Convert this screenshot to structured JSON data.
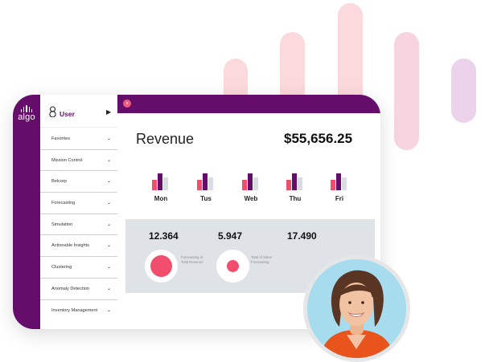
{
  "brand": {
    "logo_text": "algo"
  },
  "user": {
    "label": "User",
    "arrow": "▶"
  },
  "menu": {
    "items": [
      {
        "label": "Favorites"
      },
      {
        "label": "Mission Control"
      },
      {
        "label": "Belcorp"
      },
      {
        "label": "Forecasting"
      },
      {
        "label": "Simulation"
      },
      {
        "label": "Actionable Insights"
      },
      {
        "label": "Clustering"
      },
      {
        "label": "Anomaly Detection"
      },
      {
        "label": "Inventory Management"
      }
    ],
    "chevron": "⌄"
  },
  "topbar": {
    "button_glyph": "▾"
  },
  "revenue": {
    "title": "Revenue",
    "amount": "$55,656.25"
  },
  "week": {
    "days": [
      {
        "label": "Mon",
        "values": [
          0.42,
          0.65,
          0.5
        ]
      },
      {
        "label": "Tus",
        "values": [
          0.42,
          0.65,
          0.5
        ]
      },
      {
        "label": "Web",
        "values": [
          0.42,
          0.65,
          0.5
        ]
      },
      {
        "label": "Thu",
        "values": [
          0.42,
          0.65,
          0.5
        ]
      },
      {
        "label": "Fri",
        "values": [
          0.42,
          0.65,
          0.5
        ]
      }
    ],
    "colors": [
      "#f04e6c",
      "#650d6b",
      "#d9dde3"
    ]
  },
  "stats": {
    "values": [
      "12.364",
      "5.947",
      "17.490"
    ],
    "captions": [
      "Forecasting of Total Revenue",
      "Total of Sales Forecasting"
    ]
  },
  "colors": {
    "brand": "#650d6b",
    "accent": "#f04e6c",
    "panel": "#dfe3e8"
  }
}
